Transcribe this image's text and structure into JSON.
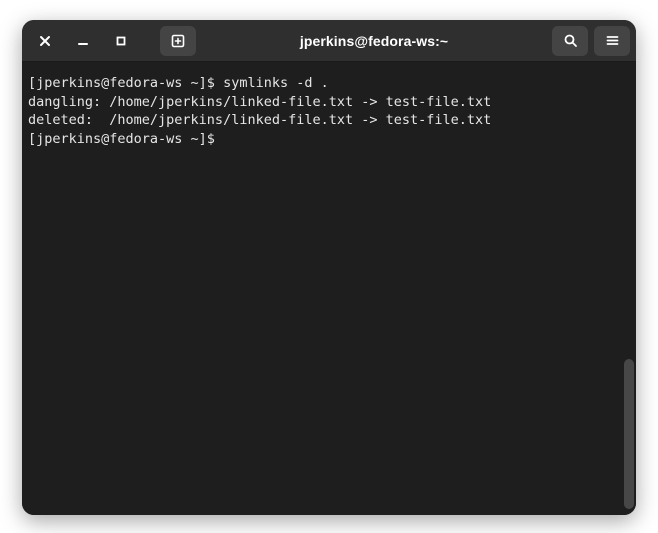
{
  "titlebar": {
    "title": "jperkins@fedora-ws:~"
  },
  "terminal": {
    "lines": [
      {
        "prompt": "[jperkins@fedora-ws ~]$ ",
        "text": "symlinks -d ."
      },
      {
        "prompt": "",
        "text": "dangling: /home/jperkins/linked-file.txt -> test-file.txt"
      },
      {
        "prompt": "",
        "text": "deleted:  /home/jperkins/linked-file.txt -> test-file.txt"
      },
      {
        "prompt": "[jperkins@fedora-ws ~]$ ",
        "text": ""
      }
    ]
  }
}
